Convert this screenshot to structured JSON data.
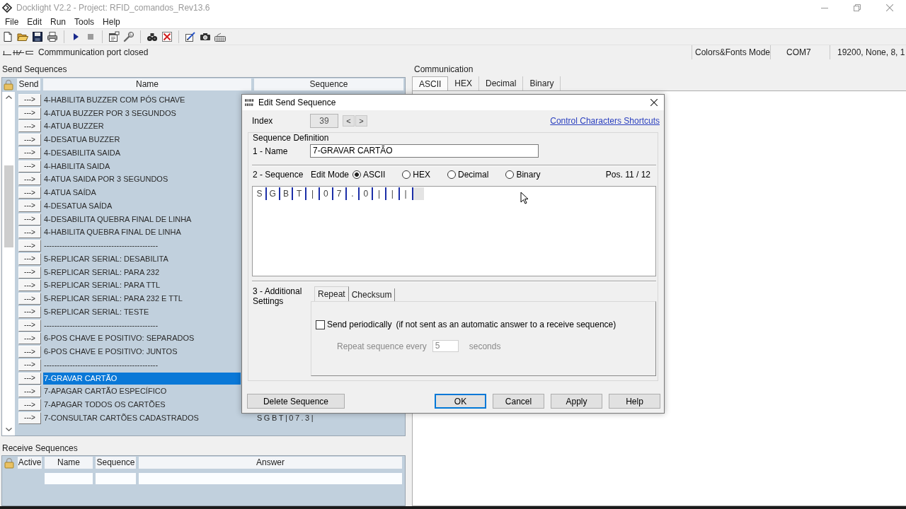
{
  "window": {
    "title": "Docklight V2.2 - Project: RFID_comandos_Rev13.6"
  },
  "menu": [
    "File",
    "Edit",
    "Run",
    "Tools",
    "Help"
  ],
  "status_bar": {
    "message": "Commmunication port closed",
    "panels": [
      "Colors&Fonts Mode",
      "COM7",
      "19200, None, 8, 1"
    ]
  },
  "send_sequences": {
    "title": "Send Sequences",
    "columns": [
      "Send",
      "Name",
      "Sequence"
    ],
    "rows": [
      {
        "send": "--->",
        "name": "4-HABILITA BUZZER COM PÓS CHAVE",
        "selected": false
      },
      {
        "send": "--->",
        "name": "4-ATUA BUZZER POR 3 SEGUNDOS",
        "selected": false
      },
      {
        "send": "--->",
        "name": "4-ATUA BUZZER",
        "selected": false
      },
      {
        "send": "--->",
        "name": "4-DESATUA BUZZER",
        "selected": false
      },
      {
        "send": "--->",
        "name": "4-DESABILITA SAIDA",
        "selected": false
      },
      {
        "send": "--->",
        "name": "4-HABILITA SAIDA",
        "selected": false
      },
      {
        "send": "--->",
        "name": "4-ATUA SAIDA POR 3 SEGUNDOS",
        "selected": false
      },
      {
        "send": "--->",
        "name": "4-ATUA SAÍDA",
        "selected": false
      },
      {
        "send": "--->",
        "name": "4-DESATUA SAÍDA",
        "selected": false
      },
      {
        "send": "--->",
        "name": "4-DESABILITA QUEBRA FINAL DE LINHA",
        "selected": false
      },
      {
        "send": "--->",
        "name": "4-HABILITA QUEBRA FINAL DE LINHA",
        "selected": false
      },
      {
        "send": "--->",
        "name": "--------------------------------------------",
        "selected": false
      },
      {
        "send": "--->",
        "name": "5-REPLICAR SERIAL: DESABILITA",
        "selected": false
      },
      {
        "send": "--->",
        "name": "5-REPLICAR SERIAL: PARA 232",
        "selected": false
      },
      {
        "send": "--->",
        "name": "5-REPLICAR SERIAL: PARA TTL",
        "selected": false
      },
      {
        "send": "--->",
        "name": "5-REPLICAR SERIAL: PARA 232 E TTL",
        "selected": false
      },
      {
        "send": "--->",
        "name": "5-REPLICAR SERIAL: TESTE",
        "selected": false
      },
      {
        "send": "--->",
        "name": "--------------------------------------------",
        "selected": false
      },
      {
        "send": "--->",
        "name": "6-POS CHAVE E POSITIVO: SEPARADOS",
        "selected": false
      },
      {
        "send": "--->",
        "name": "6-POS CHAVE E POSITIVO: JUNTOS",
        "selected": false
      },
      {
        "send": "--->",
        "name": "--------------------------------------------",
        "selected": false
      },
      {
        "send": "--->",
        "name": "7-GRAVAR CARTÃO",
        "selected": true
      },
      {
        "send": "--->",
        "name": "7-APAGAR CARTÃO ESPECÍFICO",
        "selected": false
      },
      {
        "send": "--->",
        "name": "7-APAGAR TODOS OS CARTÕES",
        "selected": false
      },
      {
        "send": "--->",
        "name": "7-CONSULTAR CARTÕES CADASTRADOS",
        "selected": false,
        "sequence": "SGBT|07.3|"
      }
    ]
  },
  "receive_sequences": {
    "title": "Receive Sequences",
    "columns": [
      "Active",
      "Name",
      "Sequence",
      "Answer"
    ]
  },
  "communication": {
    "title": "Communication",
    "tabs": [
      {
        "label": "ASCII",
        "selected": true
      },
      {
        "label": "HEX",
        "selected": false
      },
      {
        "label": "Decimal",
        "selected": false
      },
      {
        "label": "Binary",
        "selected": false
      }
    ]
  },
  "dialog": {
    "title": "Edit Send Sequence",
    "index": {
      "label": "Index",
      "value": "39",
      "buttons": [
        "<",
        ">"
      ]
    },
    "link": "Control Characters Shortcuts",
    "group_title": "Sequence Definition",
    "name": {
      "label": "1 - Name",
      "value": "7-GRAVAR CARTÃO"
    },
    "sequence": {
      "label": "2 - Sequence",
      "edit_mode_label": "Edit Mode",
      "modes": [
        {
          "label": "ASCII",
          "selected": true
        },
        {
          "label": "HEX",
          "selected": false
        },
        {
          "label": "Decimal",
          "selected": false
        },
        {
          "label": "Binary",
          "selected": false
        }
      ],
      "position": "Pos. 11 / 12",
      "chars": [
        "S",
        "G",
        "B",
        "T",
        "|",
        "0",
        "7",
        ".",
        "0",
        "|",
        "|",
        "|"
      ]
    },
    "additional": {
      "label": "3 - Additional Settings",
      "tabs": [
        {
          "label": "Repeat",
          "selected": true
        },
        {
          "label": "Checksum",
          "selected": false
        }
      ],
      "periodic": {
        "label": "Send periodically",
        "note": "(if not sent as an automatic answer to a receive sequence)",
        "checked": false
      },
      "repeat": {
        "label": "Repeat sequence every",
        "value": "5",
        "unit": "seconds",
        "disabled": true
      }
    },
    "delete_button": "Delete Sequence",
    "buttons": [
      {
        "label": "OK",
        "default": true
      },
      {
        "label": "Cancel",
        "default": false
      },
      {
        "label": "Apply",
        "default": false
      },
      {
        "label": "Help",
        "default": false
      }
    ]
  }
}
